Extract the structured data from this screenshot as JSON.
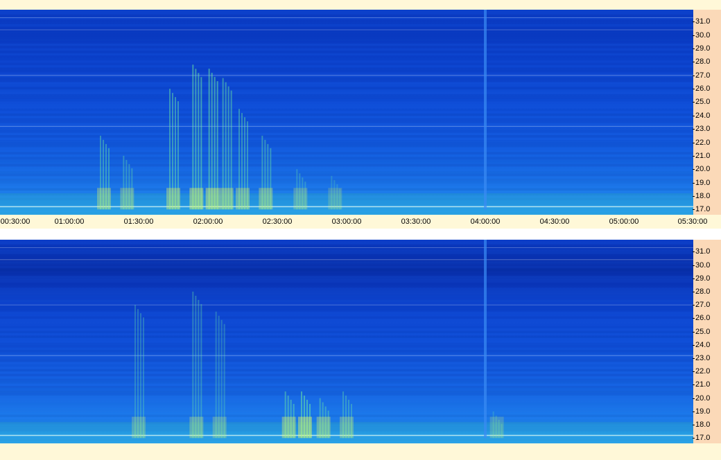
{
  "chart_data": [
    {
      "type": "heatmap",
      "title": "",
      "xlabel": "",
      "ylabel": "",
      "x_ticks": [
        "00:30:00",
        "01:00:00",
        "01:30:00",
        "02:00:00",
        "02:30:00",
        "03:00:00",
        "03:30:00",
        "04:00:00",
        "04:30:00",
        "05:00:00",
        "05:30:00"
      ],
      "y_ticks": [
        "31.0",
        "30.0",
        "29.0",
        "28.0",
        "27.0",
        "26.0",
        "25.0",
        "24.0",
        "23.0",
        "22.0",
        "21.0",
        "20.0",
        "19.0",
        "18.0",
        "17.0"
      ],
      "xlim": [
        "00:30:00",
        "05:30:00"
      ],
      "ylim": [
        16.6,
        31.9
      ],
      "colors": {
        "background_low": "#0a3cc6",
        "background_high": "#2aa0f4",
        "activity": "#6ff0a0",
        "activity_hot": "#f4ff5a",
        "interference": "#ffffff"
      },
      "bursts": [
        {
          "time": "01:15:00",
          "freq_min": 17.0,
          "freq_max": 22.5,
          "intensity": 0.7
        },
        {
          "time": "01:25:00",
          "freq_min": 17.0,
          "freq_max": 21.0,
          "intensity": 0.6
        },
        {
          "time": "01:45:00",
          "freq_min": 17.0,
          "freq_max": 26.0,
          "intensity": 0.8
        },
        {
          "time": "01:55:00",
          "freq_min": 17.0,
          "freq_max": 27.8,
          "intensity": 0.9
        },
        {
          "time": "02:02:00",
          "freq_min": 17.0,
          "freq_max": 27.5,
          "intensity": 0.9
        },
        {
          "time": "02:08:00",
          "freq_min": 17.0,
          "freq_max": 26.8,
          "intensity": 0.8
        },
        {
          "time": "02:15:00",
          "freq_min": 17.0,
          "freq_max": 24.5,
          "intensity": 0.7
        },
        {
          "time": "02:25:00",
          "freq_min": 17.0,
          "freq_max": 22.5,
          "intensity": 0.7
        },
        {
          "time": "02:40:00",
          "freq_min": 17.0,
          "freq_max": 20.0,
          "intensity": 0.5
        },
        {
          "time": "02:55:00",
          "freq_min": 17.0,
          "freq_max": 19.5,
          "intensity": 0.4
        }
      ],
      "vertical_streaks": [
        {
          "time": "04:00:00",
          "freq_min": 17.0,
          "freq_max": 31.9
        }
      ],
      "horizontal_lines": [
        31.3,
        30.4,
        27.0,
        23.2,
        17.2
      ]
    },
    {
      "type": "heatmap",
      "title": "",
      "xlabel": "",
      "ylabel": "",
      "y_ticks": [
        "31.0",
        "30.0",
        "29.0",
        "28.0",
        "27.0",
        "26.0",
        "25.0",
        "24.0",
        "23.0",
        "22.0",
        "21.0",
        "20.0",
        "19.0",
        "18.0",
        "17.0"
      ],
      "ylim": [
        16.6,
        31.9
      ],
      "colors": {
        "background_low": "#082ea8",
        "background_high": "#2aa0f4",
        "activity": "#6ff0a0",
        "activity_hot": "#f4ff5a",
        "interference": "#ffffff"
      },
      "bursts": [
        {
          "time": "01:30:00",
          "freq_min": 17.0,
          "freq_max": 27.0,
          "intensity": 0.5
        },
        {
          "time": "01:55:00",
          "freq_min": 17.0,
          "freq_max": 28.0,
          "intensity": 0.6
        },
        {
          "time": "02:05:00",
          "freq_min": 17.0,
          "freq_max": 26.5,
          "intensity": 0.5
        },
        {
          "time": "02:35:00",
          "freq_min": 17.0,
          "freq_max": 20.5,
          "intensity": 0.8
        },
        {
          "time": "02:42:00",
          "freq_min": 17.0,
          "freq_max": 20.5,
          "intensity": 0.9
        },
        {
          "time": "02:50:00",
          "freq_min": 17.0,
          "freq_max": 20.0,
          "intensity": 0.7
        },
        {
          "time": "03:00:00",
          "freq_min": 17.0,
          "freq_max": 20.5,
          "intensity": 0.6
        },
        {
          "time": "04:05:00",
          "freq_min": 17.0,
          "freq_max": 19.0,
          "intensity": 0.4
        }
      ],
      "vertical_streaks": [
        {
          "time": "04:00:00",
          "freq_min": 17.0,
          "freq_max": 31.9
        }
      ],
      "horizontal_lines": [
        31.3,
        30.4,
        27.0,
        23.2,
        17.2
      ]
    }
  ]
}
